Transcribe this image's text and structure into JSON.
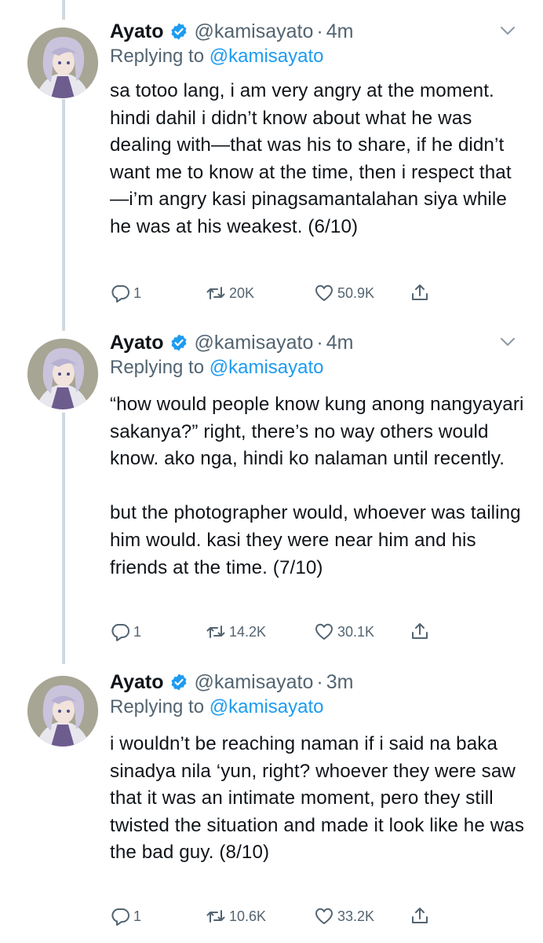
{
  "tweets": [
    {
      "name": "Ayato",
      "handle": "@kamisayato",
      "separator": "·",
      "time": "4m",
      "replying_prefix": "Replying to",
      "replying_to": "@kamisayato",
      "text": "sa totoo lang, i am very angry at the moment. hindi dahil i didn’t know about what he was dealing with—that was his to share, if he didn’t want me to know at the time, then i respect that—i’m angry kasi pinagsamantalahan siya while he was at his weakest. (6/10)",
      "replies": "1",
      "retweets": "20K",
      "likes": "50.9K"
    },
    {
      "name": "Ayato",
      "handle": "@kamisayato",
      "separator": "·",
      "time": "4m",
      "replying_prefix": "Replying to",
      "replying_to": "@kamisayato",
      "text": "“how would people know kung anong nangyayari sakanya?” right, there’s no way others would know. ako nga, hindi ko nalaman until recently.\n\nbut the photographer would, whoever was tailing him would. kasi they were near him and his friends at the time. (7/10)",
      "replies": "1",
      "retweets": "14.2K",
      "likes": "30.1K"
    },
    {
      "name": "Ayato",
      "handle": "@kamisayato",
      "separator": "·",
      "time": "3m",
      "replying_prefix": "Replying to",
      "replying_to": "@kamisayato",
      "text": "i wouldn’t be reaching naman if i said na baka sinadya nila ‘yun, right? whoever they were saw that it was an intimate moment, pero they still twisted the situation and made it look like he was the bad guy. (8/10)",
      "replies": "1",
      "retweets": "10.6K",
      "likes": "33.2K"
    }
  ],
  "colors": {
    "text": "#0f1419",
    "secondary": "#536471",
    "link": "#1d9bf0",
    "verified": "#1d9bf0",
    "thread_line": "#cfd9de"
  },
  "icons": [
    "verified-badge-icon",
    "chevron-down-icon",
    "reply-icon",
    "retweet-icon",
    "like-icon",
    "share-icon"
  ]
}
